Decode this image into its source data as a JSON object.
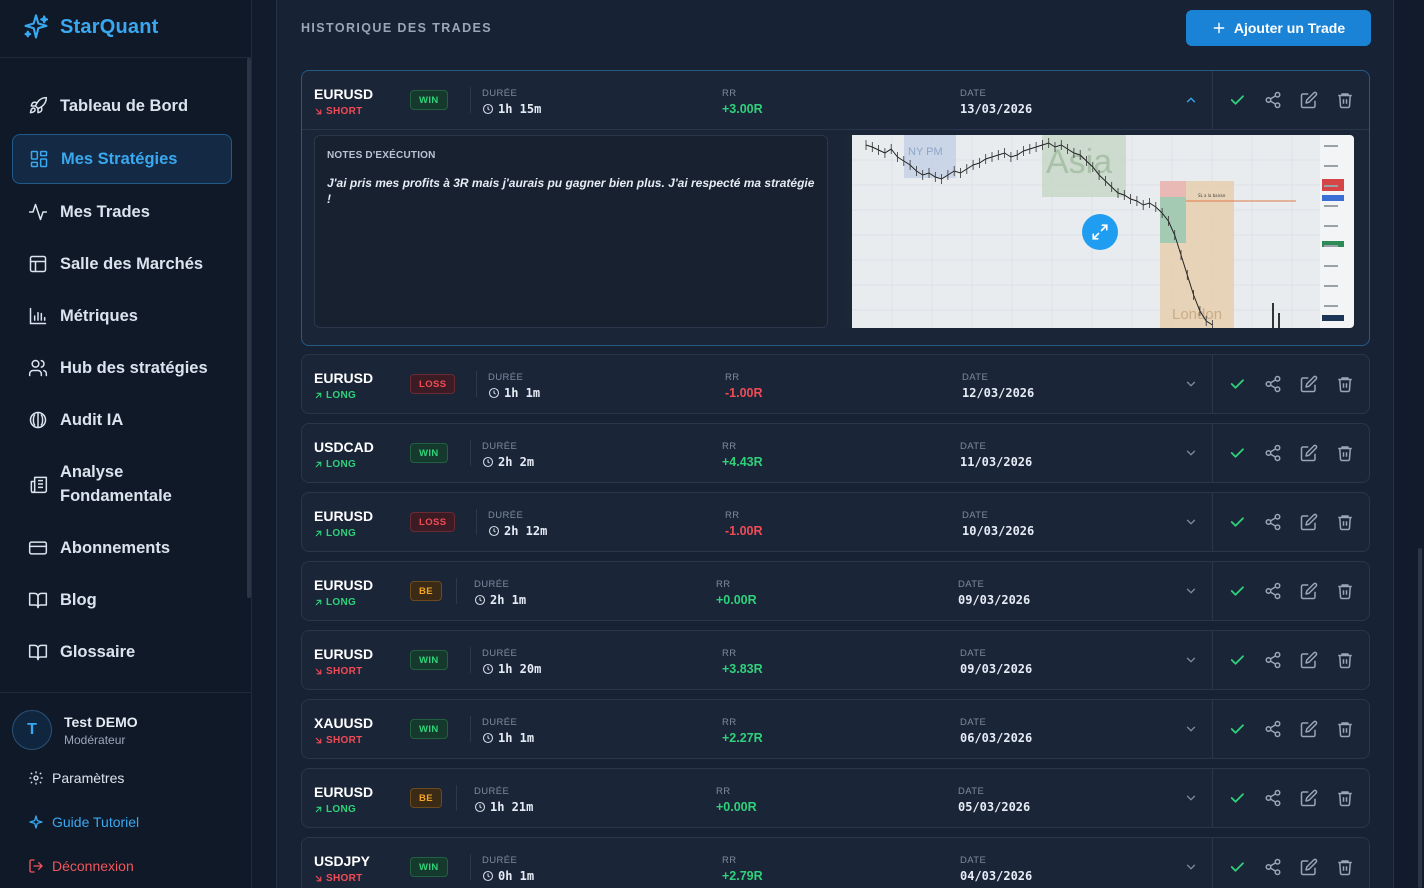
{
  "app": {
    "name": "StarQuant"
  },
  "sidebar": {
    "items": [
      {
        "label": "Tableau de Bord",
        "icon": "rocket-icon"
      },
      {
        "label": "Mes Stratégies",
        "icon": "grid-icon",
        "active": true
      },
      {
        "label": "Mes Trades",
        "icon": "activity-icon"
      },
      {
        "label": "Salle des Marchés",
        "icon": "layout-icon"
      },
      {
        "label": "Métriques",
        "icon": "bar-chart-icon"
      },
      {
        "label": "Hub des stratégies",
        "icon": "users-icon"
      },
      {
        "label": "Audit IA",
        "icon": "brain-icon"
      },
      {
        "label": "Analyse Fondamentale",
        "icon": "newspaper-icon"
      },
      {
        "label": "Abonnements",
        "icon": "credit-card-icon"
      },
      {
        "label": "Blog",
        "icon": "book-icon"
      },
      {
        "label": "Glossaire",
        "icon": "book-open-icon"
      }
    ],
    "user": {
      "initial": "T",
      "name": "Test DEMO",
      "role": "Modérateur"
    },
    "settings_label": "Paramètres",
    "tutorial_label": "Guide Tutoriel",
    "logout_label": "Déconnexion"
  },
  "main": {
    "title": "HISTORIQUE DES TRADES",
    "add_button": "Ajouter un Trade",
    "labels": {
      "duration": "DURÉE",
      "rr": "RR",
      "date": "DATE"
    },
    "notes_title": "NOTES D'EXÉCUTION"
  },
  "trades": [
    {
      "pair": "EURUSD",
      "direction": "SHORT",
      "result": "WIN",
      "duration": "1h 15m",
      "rr": "+3.00R",
      "date": "13/03/2026",
      "expanded": true,
      "notes": "J'ai pris mes profits à 3R mais j'aurais pu gagner bien plus. J'ai respecté ma stratégie !"
    },
    {
      "pair": "EURUSD",
      "direction": "LONG",
      "result": "LOSS",
      "duration": "1h 1m",
      "rr": "-1.00R",
      "date": "12/03/2026"
    },
    {
      "pair": "USDCAD",
      "direction": "LONG",
      "result": "WIN",
      "duration": "2h 2m",
      "rr": "+4.43R",
      "date": "11/03/2026"
    },
    {
      "pair": "EURUSD",
      "direction": "LONG",
      "result": "LOSS",
      "duration": "2h 12m",
      "rr": "-1.00R",
      "date": "10/03/2026"
    },
    {
      "pair": "EURUSD",
      "direction": "LONG",
      "result": "BE",
      "duration": "2h 1m",
      "rr": "+0.00R",
      "date": "09/03/2026"
    },
    {
      "pair": "EURUSD",
      "direction": "SHORT",
      "result": "WIN",
      "duration": "1h 20m",
      "rr": "+3.83R",
      "date": "09/03/2026"
    },
    {
      "pair": "XAUUSD",
      "direction": "SHORT",
      "result": "WIN",
      "duration": "1h 1m",
      "rr": "+2.27R",
      "date": "06/03/2026"
    },
    {
      "pair": "EURUSD",
      "direction": "LONG",
      "result": "BE",
      "duration": "1h 21m",
      "rr": "+0.00R",
      "date": "05/03/2026"
    },
    {
      "pair": "USDJPY",
      "direction": "SHORT",
      "result": "WIN",
      "duration": "0h 1m",
      "rr": "+2.79R",
      "date": "04/03/2026"
    }
  ],
  "chart_image": {
    "session_labels": [
      "NY PM",
      "Asia",
      "London"
    ]
  },
  "colors": {
    "accent": "#1a83d6",
    "win": "#2fd17a",
    "loss": "#f24b55",
    "be": "#f5a524"
  }
}
